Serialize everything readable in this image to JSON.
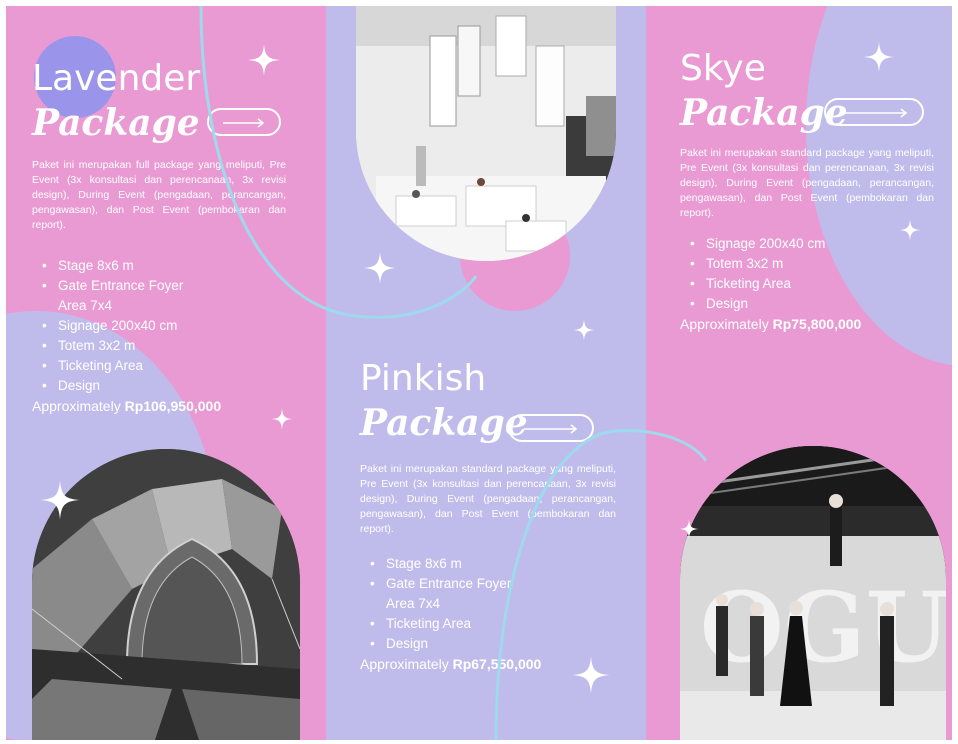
{
  "colors": {
    "pink": "#ea9ad3",
    "lavender": "#bfbceb",
    "text": "#ffffff",
    "accent_line": "#9fd9ee",
    "circle_blue": "#9a95ea"
  },
  "lavender": {
    "title": "Lavender",
    "subtitle": "Package",
    "description": "Paket ini merupakan full package yang meliputi, Pre Event (3x konsultasi dan perencanaan, 3x revisi design), During Event (pengadaan, perancangan, pengawasan), dan Post Event (pembokaran dan report).",
    "features": [
      "Stage 8x6 m",
      "Gate Entrance Foyer Area 7x4",
      "Signage 200x40 cm",
      "Totem 3x2 m",
      "Ticketing Area",
      "Design"
    ],
    "price_prefix": "Approximately",
    "price": "Rp106,950,000"
  },
  "pinkish": {
    "title": "Pinkish",
    "subtitle": "Package",
    "description": "Paket ini merupakan standard package yang meliputi, Pre Event (3x konsultasi dan perencanaan, 3x revisi design), During Event (pengadaan, perancangan, pengawasan), dan Post Event (pembokaran dan report).",
    "features": [
      "Stage 8x6 m",
      "Gate Entrance Foyer Area 7x4",
      "Ticketing Area",
      "Design"
    ],
    "price_prefix": "Approximately",
    "price": "Rp67,550,000"
  },
  "skye": {
    "title": "Skye",
    "subtitle": "Package",
    "description": "Paket ini merupakan standard package yang meliputi, Pre Event (3x konsultasi dan perencanaan, 3x revisi design), During Event (pengadaan, perancangan, pengawasan), dan Post Event (pembokaran dan report).",
    "features": [
      "Signage 200x40 cm",
      "Totem 3x2 m",
      "Ticketing Area",
      "Design"
    ],
    "price_prefix": "Approximately",
    "price": "Rp75,800,000"
  },
  "icons": {
    "arrow": "arrow-right-icon",
    "sparkle": "sparkle-icon"
  }
}
